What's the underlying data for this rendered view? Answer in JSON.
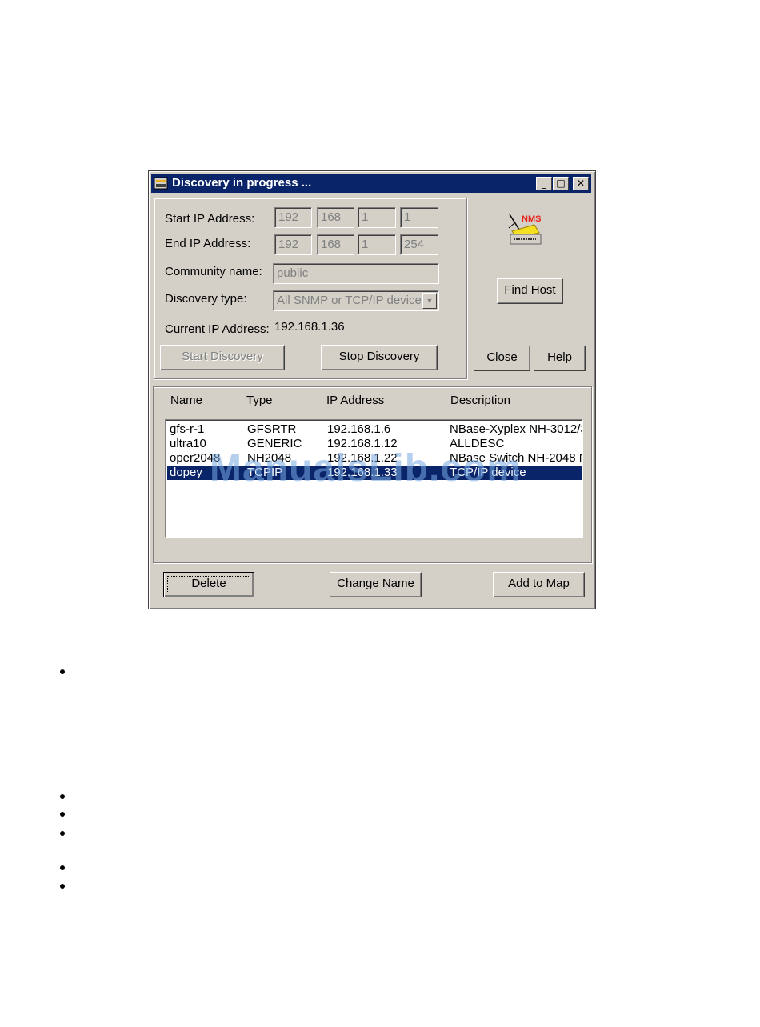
{
  "window": {
    "title": "Discovery in progress ...",
    "controls": {
      "minimize": "_",
      "maximize": "□",
      "close": "✕"
    }
  },
  "form": {
    "start_ip_label": "Start IP Address:",
    "start_ip": [
      "192",
      "168",
      "1",
      "1"
    ],
    "end_ip_label": "End IP Address:",
    "end_ip": [
      "192",
      "168",
      "1",
      "254"
    ],
    "community_label": "Community name:",
    "community_value": "public",
    "discovery_type_label": "Discovery type:",
    "discovery_type_value": "All SNMP or TCP/IP device",
    "current_ip_label": "Current IP Address:",
    "current_ip_value": "192.168.1.36"
  },
  "buttons": {
    "start_discovery": "Start Discovery",
    "stop_discovery": "Stop Discovery",
    "find_host": "Find Host",
    "close": "Close",
    "help": "Help",
    "delete": "Delete",
    "change_name": "Change Name",
    "add_to_map": "Add to Map"
  },
  "logo": {
    "text": "NMS",
    "color": "#e8221c"
  },
  "list": {
    "columns": [
      "Name",
      "Type",
      "IP Address",
      "Description"
    ],
    "rows": [
      {
        "name": "gfs-r-1",
        "type": "GFSRTR",
        "ip": "192.168.1.6",
        "description": "NBase-Xyplex NH-3012/3"
      },
      {
        "name": "ultra10",
        "type": "GENERIC",
        "ip": "192.168.1.12",
        "description": "ALLDESC"
      },
      {
        "name": "oper2048",
        "type": "NH2048",
        "ip": "192.168.1.22",
        "description": "NBase Switch NH-2048 N"
      },
      {
        "name": "dopey",
        "type": "TCPIP",
        "ip": "192.168.1.33",
        "description": "TCP/IP device",
        "selected": true
      }
    ]
  },
  "watermark": "ManualsLib.com",
  "colors": {
    "dialog_bg": "#d4d0c8",
    "titlebar": "#0a246a",
    "selection": "#0a246a"
  }
}
